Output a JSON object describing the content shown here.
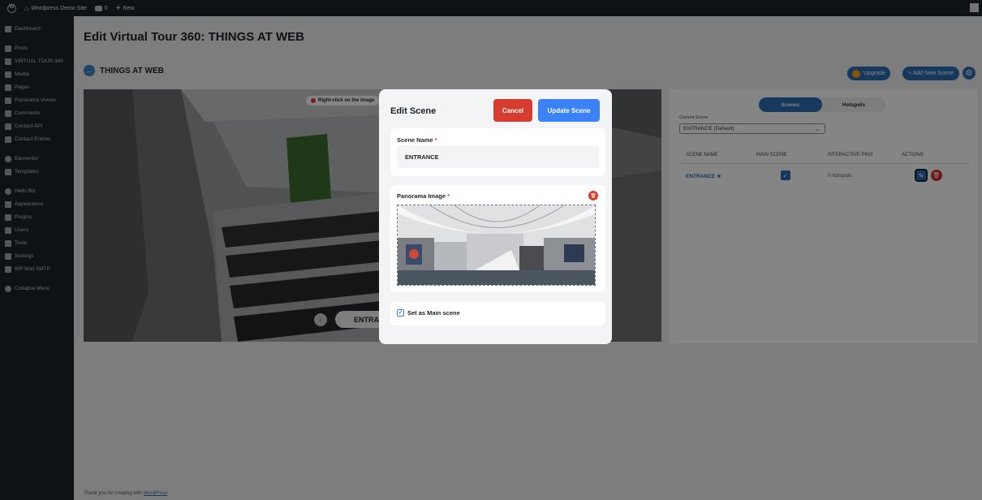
{
  "adminbar": {
    "site_name": "Wordpress Demo Site",
    "comments_count": "0",
    "new_label": "New"
  },
  "sidebar": {
    "items": [
      {
        "label": "Dashboard",
        "icon": "dashboard-icon"
      },
      {
        "label": "Posts",
        "icon": "pin-icon"
      },
      {
        "label": "VIRTUAL TOUR 360",
        "icon": "tour-icon"
      },
      {
        "label": "Media",
        "icon": "media-icon"
      },
      {
        "label": "Pages",
        "icon": "pages-icon"
      },
      {
        "label": "Panorama Viewer",
        "icon": "panorama-icon"
      },
      {
        "label": "Comments",
        "icon": "comments-icon"
      },
      {
        "label": "Contact API",
        "icon": "contact-api-icon"
      },
      {
        "label": "Contact Entries",
        "icon": "contact-entries-icon"
      },
      {
        "label": "Elementor",
        "icon": "elementor-icon"
      },
      {
        "label": "Templates",
        "icon": "templates-icon"
      },
      {
        "label": "Hello Biz",
        "icon": "hello-biz-icon"
      },
      {
        "label": "Appearance",
        "icon": "appearance-icon"
      },
      {
        "label": "Plugins",
        "icon": "plugins-icon"
      },
      {
        "label": "Users",
        "icon": "users-icon"
      },
      {
        "label": "Tools",
        "icon": "tools-icon"
      },
      {
        "label": "Settings",
        "icon": "settings-icon"
      },
      {
        "label": "WP Mail SMTP",
        "icon": "mail-icon"
      },
      {
        "label": "Collapse Menu",
        "icon": "collapse-icon"
      }
    ]
  },
  "page": {
    "title": "Edit Virtual Tour 360: THINGS AT WEB",
    "tour_name": "THINGS AT WEB",
    "upgrade_label": "Upgrade",
    "add_scene_label": "+ Add New Scene"
  },
  "viewer": {
    "hint": "Right-click on the image",
    "scene_pill": "ENTRANCE"
  },
  "panel": {
    "tabs": [
      {
        "label": "Scenes",
        "active": true
      },
      {
        "label": "Hotspots",
        "active": false
      }
    ],
    "current_scene_label": "Current Scene",
    "current_scene_value": "ENTRANCE (Default)",
    "columns": [
      "SCENE NAME",
      "MAIN SCENE",
      "INTERACTIVE PINS",
      "ACTIONS"
    ],
    "rows": [
      {
        "scene": "ENTRANCE ★",
        "main": true,
        "pins": "0 hotspots"
      }
    ]
  },
  "modal": {
    "title": "Edit Scene",
    "cancel_label": "Cancel",
    "update_label": "Update Scene",
    "scene_name_label": "Scene Name",
    "scene_name_value": "ENTRANCE",
    "pano_label": "Panorama Image",
    "required_mark": "*",
    "main_scene_label": "Set as Main scene",
    "main_scene_checked": true
  },
  "footer": {
    "text": "Thank you for creating with ",
    "link": "WordPress"
  },
  "colors": {
    "primary": "#2b6cb0",
    "danger": "#d63c2f",
    "update": "#3b82f6",
    "admin_dark": "#1d2327"
  }
}
